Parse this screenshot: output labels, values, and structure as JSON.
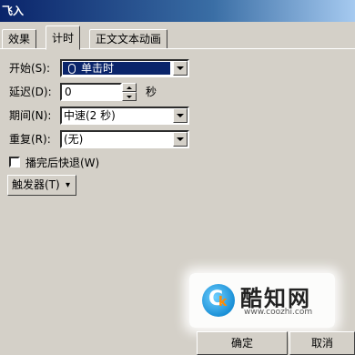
{
  "title": "飞入",
  "tabs": [
    "效果",
    "计时",
    "正文文本动画"
  ],
  "start": {
    "label": "开始(S):",
    "value": "单击时"
  },
  "delay": {
    "label": "延迟(D):",
    "value": "0",
    "unit": "秒"
  },
  "period": {
    "label": "期间(N):",
    "value": "中速(2 秒)"
  },
  "repeat": {
    "label": "重复(R):",
    "value": "(无)"
  },
  "rewind": {
    "label": "播完后快退(W)"
  },
  "trigger": {
    "label": "触发器(T)"
  },
  "buttons": {
    "ok": "确定",
    "cancel": "取消"
  },
  "watermark": {
    "name": "酷知网",
    "url": "www.coozhi.com"
  }
}
